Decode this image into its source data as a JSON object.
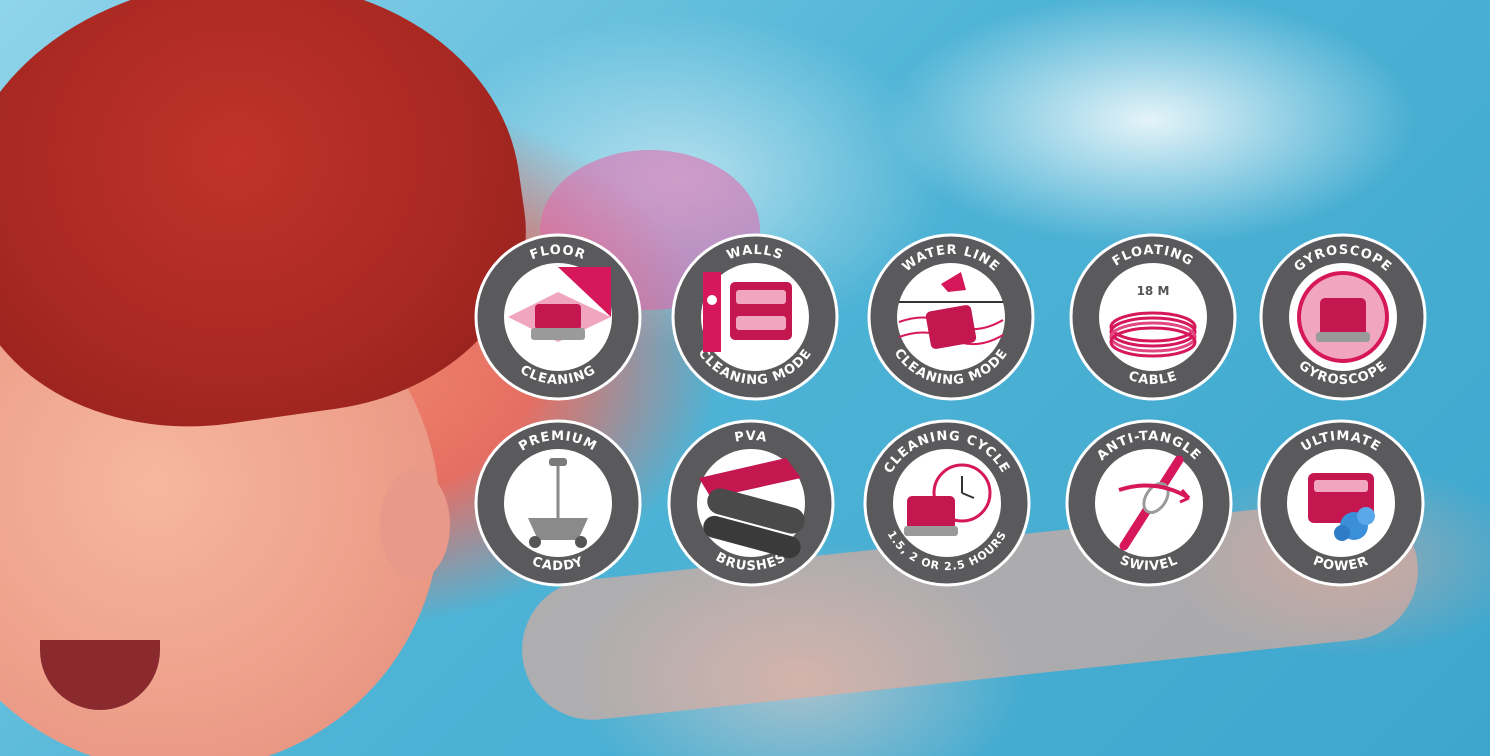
{
  "colors": {
    "badge_ring": "#5a5a5c",
    "badge_inner": "#ffffff",
    "accent": "#d6185b",
    "accent_light": "#f1a6c0"
  },
  "badges": [
    {
      "top": "FLOOR",
      "bottom": "CLEANING",
      "icon": "floor-robot-icon"
    },
    {
      "top": "WALLS",
      "bottom": "CLEANING MODE",
      "icon": "wall-robot-icon"
    },
    {
      "top": "WATER LINE",
      "bottom": "CLEANING MODE",
      "icon": "waterline-robot-icon"
    },
    {
      "top": "FLOATING",
      "bottom": "CABLE",
      "inner": "18 M",
      "icon": "cable-coil-icon"
    },
    {
      "top": "GYROSCOPE",
      "bottom": "GYROSCOPE",
      "icon": "gyroscope-robot-icon"
    },
    {
      "top": "PREMIUM",
      "bottom": "CADDY",
      "icon": "caddy-icon"
    },
    {
      "top": "PVA",
      "bottom": "BRUSHES",
      "icon": "pva-brush-icon"
    },
    {
      "top": "CLEANING CYCLE",
      "bottom": "1.5, 2 OR 2.5 HOURS",
      "icon": "cycle-timer-icon"
    },
    {
      "top": "ANTI-TANGLE",
      "bottom": "SWIVEL",
      "icon": "swivel-icon"
    },
    {
      "top": "ULTIMATE",
      "bottom": "POWER",
      "icon": "power-robot-icon"
    }
  ]
}
